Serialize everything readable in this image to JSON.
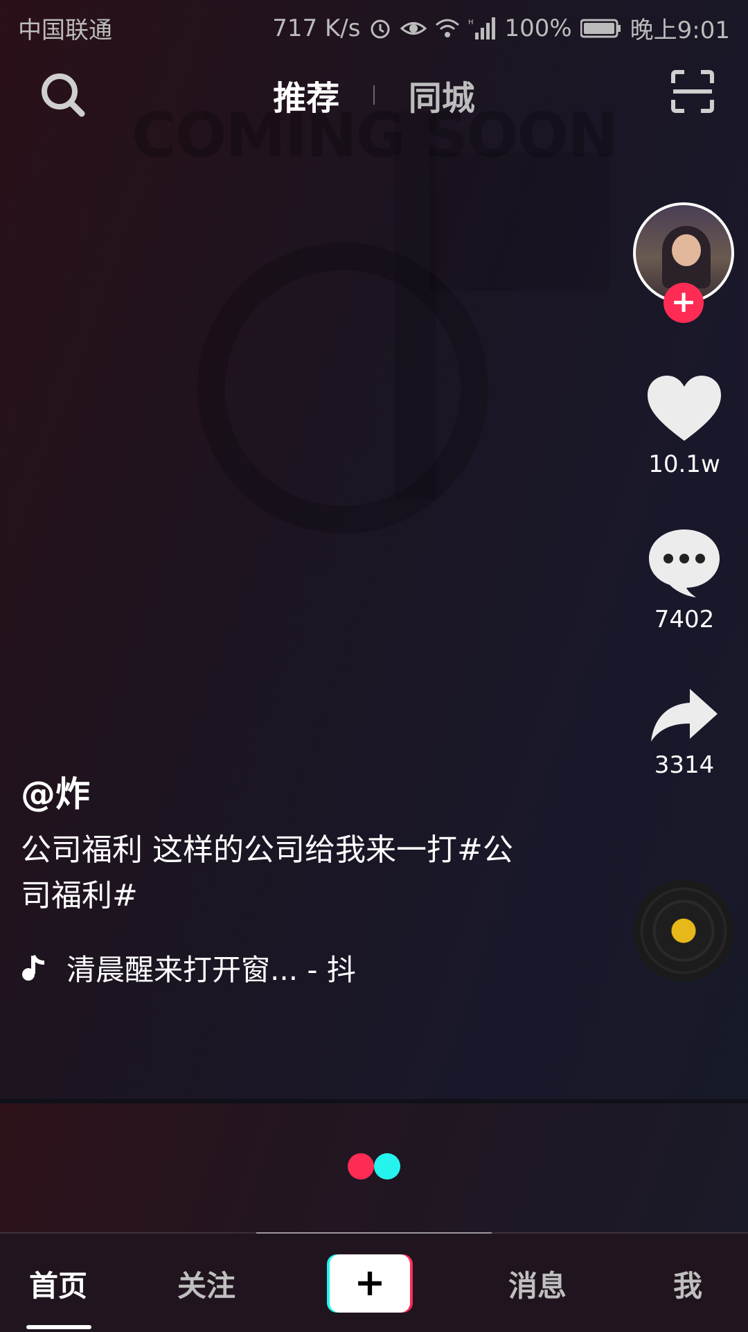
{
  "status_bar": {
    "carrier": "中国联通",
    "net_speed": "717 K/s",
    "battery": "100%",
    "time": "晚上9:01"
  },
  "top_nav": {
    "tabs": [
      {
        "label": "推荐",
        "active": true
      },
      {
        "label": "同城",
        "active": false
      }
    ],
    "icons": {
      "search": "search-icon",
      "scan": "scan-icon"
    }
  },
  "video": {
    "author": "@炸",
    "caption": "公司福利  这样的公司给我来一打#公司福利#",
    "music": "清晨醒来打开窗... - 抖",
    "background_text": "COMING SOON"
  },
  "actions": {
    "likes": "10.1w",
    "comments": "7402",
    "shares": "3314",
    "follow_label": "+"
  },
  "bottom_tabs": {
    "home": "首页",
    "follow": "关注",
    "create": "+",
    "messages": "消息",
    "me": "我"
  },
  "colors": {
    "accent_red": "#fe2c55",
    "accent_cyan": "#25f4ee",
    "disc_center": "#e6b81a"
  }
}
